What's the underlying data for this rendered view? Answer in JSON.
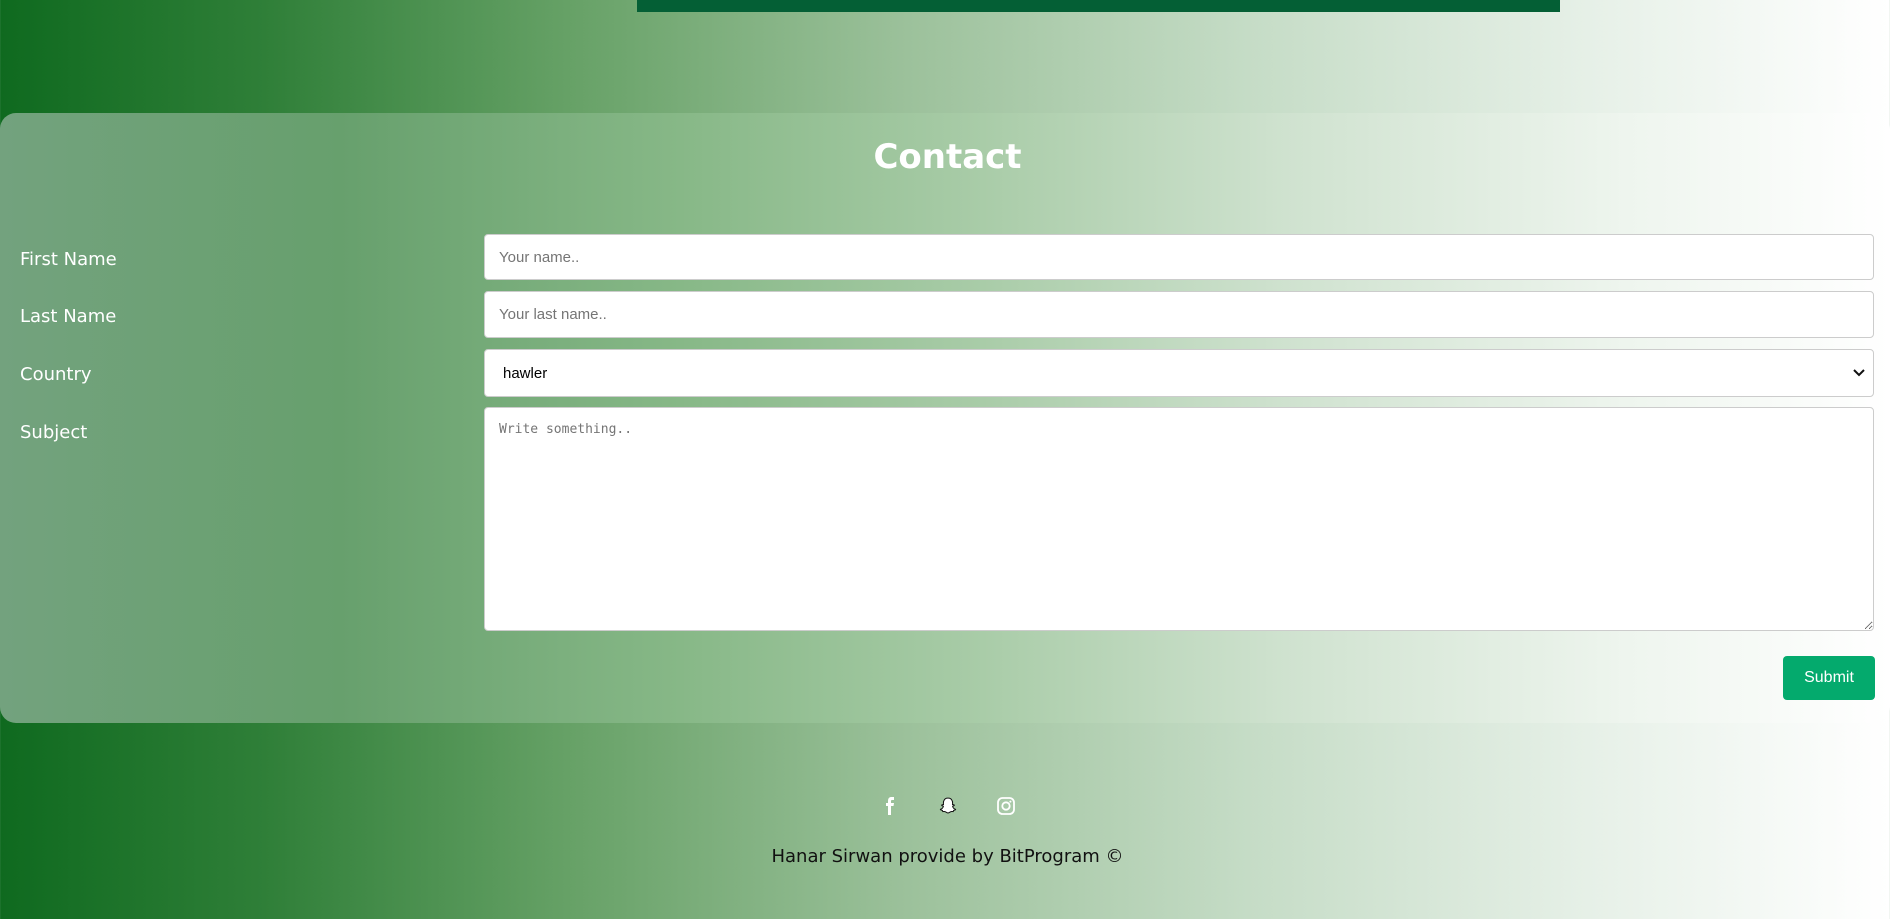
{
  "header": {
    "accent_bar_color": "#045f35"
  },
  "contact": {
    "title": "Contact",
    "fields": {
      "first_name": {
        "label": "First Name",
        "placeholder": "Your name.."
      },
      "last_name": {
        "label": "Last Name",
        "placeholder": "Your last name.."
      },
      "country": {
        "label": "Country",
        "selected": "hawler"
      },
      "subject": {
        "label": "Subject",
        "placeholder": "Write something.."
      }
    },
    "submit_label": "Submit",
    "submit_color": "#04aa6d"
  },
  "footer": {
    "social_icons": [
      "facebook-icon",
      "snapchat-icon",
      "instagram-icon"
    ],
    "text": "Hanar Sirwan provide by BitProgram ©"
  }
}
